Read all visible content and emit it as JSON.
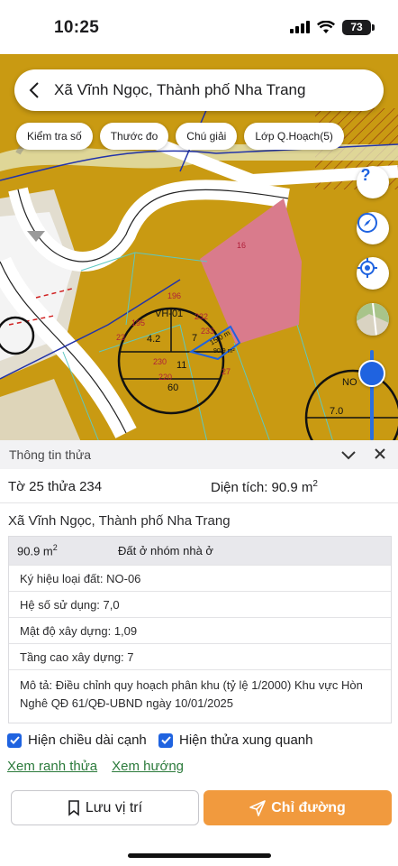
{
  "status_bar": {
    "time": "10:25",
    "battery": "73"
  },
  "search": {
    "title": "Xã Vĩnh Ngọc, Thành phố Nha Trang"
  },
  "chips": [
    "Kiểm tra số",
    "Thước đo",
    "Chú giải",
    "Lớp Q.Hoạch(5)"
  ],
  "map_labels": {
    "lot_16": "16",
    "lot_196": "196",
    "lot_195": "195",
    "lot_232": "232",
    "lot_233": "233",
    "lot_23": "23",
    "lot_230": "230",
    "lot_220": "220",
    "lot_27": "27",
    "lot_60": "60",
    "zone_vh01": "VH-01",
    "zone_no": "NO",
    "circle_4_2": "4.2",
    "circle_7": "7",
    "circle_11": "11",
    "circle_7_0": "7.0",
    "dimension": "15.0 m",
    "area_small": "90.9 m²"
  },
  "panel": {
    "title": "Thông tin thửa",
    "parcel_no": "Tờ 25 thửa 234",
    "area_label": "Diện tích: 90.9 m",
    "area_sup": "2",
    "address": "Xã Vĩnh Ngọc, Thành phố Nha Trang",
    "plan_area": "90.9 m",
    "plan_area_sup": "2",
    "plan_use": "Đất ở nhóm nhà ở",
    "rows": [
      "Ký hiệu loại đất: NO-06",
      "Hệ số sử dụng: 7,0",
      "Mật độ xây dựng: 1,09",
      "Tầng cao xây dựng: 7"
    ],
    "description": "Mô tả: Điều chỉnh quy hoạch phân khu (tỷ lệ 1/2000) Khu vực Hòn Nghê QĐ 61/QĐ-UBND ngày 10/01/2025"
  },
  "checkboxes": {
    "show_lengths": "Hiện chiều dài cạnh",
    "show_neighbors": "Hiện thửa xung quanh"
  },
  "links": {
    "view_boundary": "Xem ranh thửa",
    "view_direction": "Xem hướng"
  },
  "buttons": {
    "save": "Lưu vị trí",
    "directions": "Chỉ đường"
  },
  "colors": {
    "map_base": "#c99a12",
    "pink_zone": "#d97b8c",
    "primary_blue": "#1f63e0",
    "orange": "#f19a3e",
    "link_green": "#2b7a3b"
  }
}
